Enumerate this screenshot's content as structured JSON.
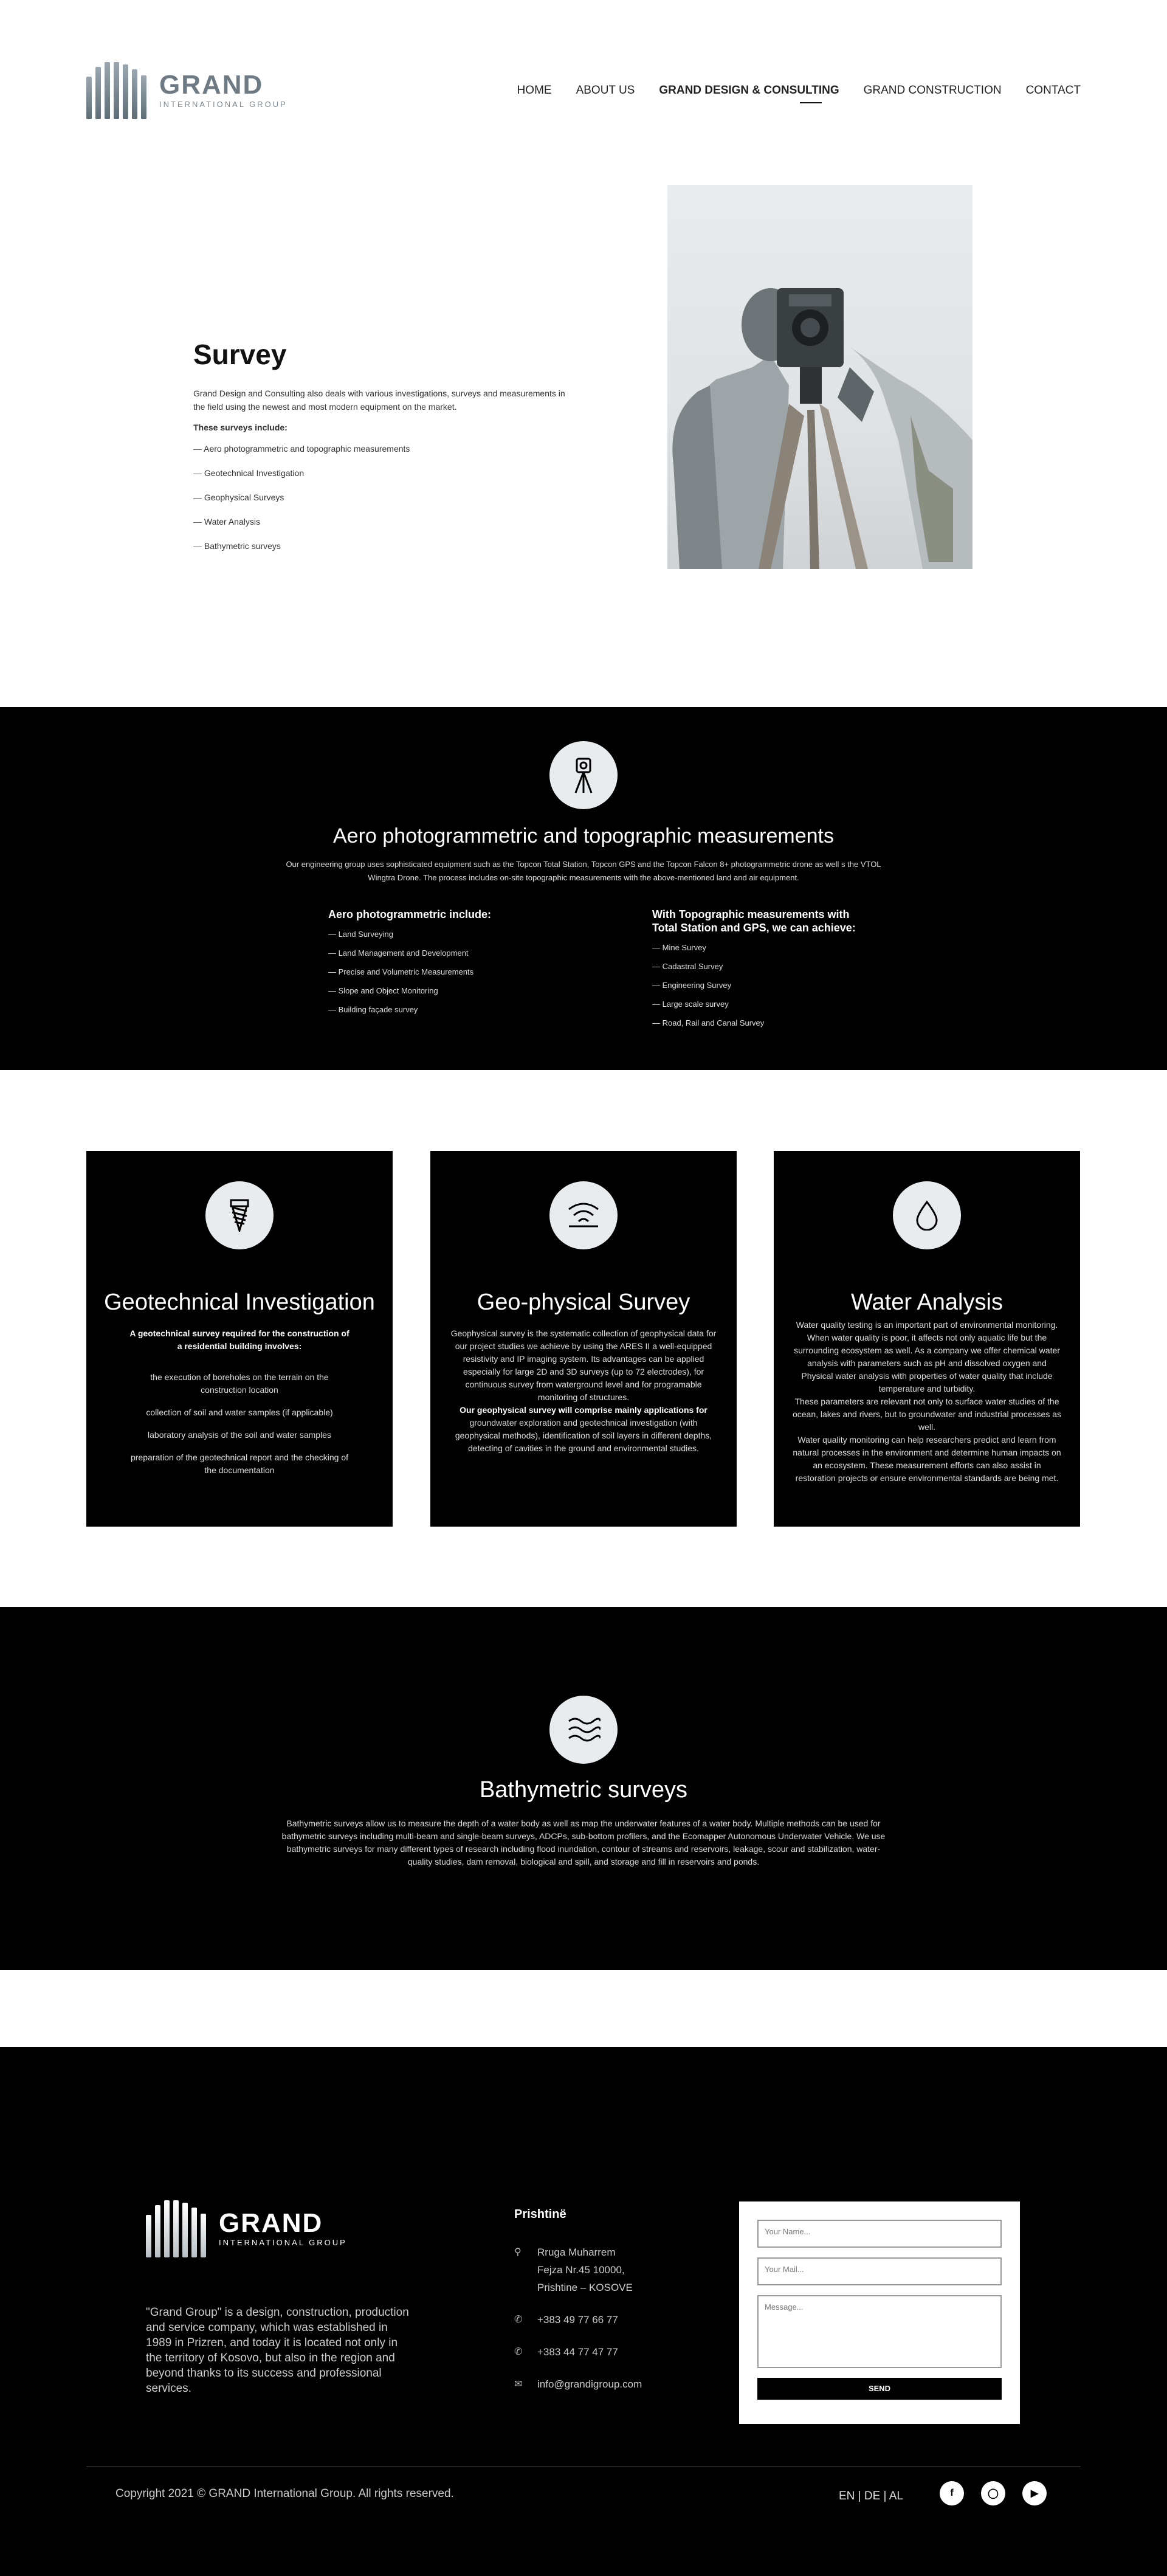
{
  "header": {
    "logo": {
      "name": "GRAND",
      "tagline": "INTERNATIONAL GROUP"
    },
    "nav": [
      "HOME",
      "ABOUT US",
      "GRAND DESIGN & CONSULTING",
      "GRAND CONSTRUCTION",
      "CONTACT"
    ]
  },
  "survey": {
    "title": "Survey",
    "description": "Grand Design and Consulting also deals with various investigations, surveys and measurements in the field using the newest and most modern equipment on the market.",
    "include_label": "These surveys include:",
    "items": [
      "Aero photogrammetric and topographic measurements",
      "Geotechnical Investigation",
      "Geophysical Surveys",
      "Water Analysis",
      "Bathymetric surveys"
    ]
  },
  "aero": {
    "title": "Aero photogrammetric and topographic measurements",
    "description": "Our engineering group uses sophisticated equipment such as the Topcon Total Station, Topcon GPS and the Topcon Falcon 8+ photogrammetric drone as well s the VTOL Wingtra Drone. The process includes on-site topographic measurements with the above-mentioned land and air equipment.",
    "left_title": "Aero photogrammetric include:",
    "left_items": [
      "Land Surveying",
      "Land Management and Development",
      "Precise and Volumetric Measurements",
      "Slope and Object Monitoring",
      "Building façade survey"
    ],
    "right_title": "With Topographic measurements with Total Station and GPS, we can achieve:",
    "right_items": [
      "Mine Survey",
      "Cadastral Survey",
      "Engineering Survey",
      "Large scale survey",
      "Road, Rail and Canal Survey"
    ]
  },
  "cards": {
    "geotech": {
      "title": "Geotechnical Investigation",
      "lead": "A geotechnical survey required for the construction of a residential building involves:",
      "items": [
        "the execution of boreholes on the terrain on the construction location",
        "collection of soil and water samples (if applicable)",
        "laboratory analysis of the soil and water samples",
        "preparation of the geotechnical report and the checking of the documentation"
      ]
    },
    "geophys": {
      "title": "Geo-physical Survey",
      "body": "Geophysical survey is the systematic collection of geophysical data for our project studies we achieve by using the ARES II a well-equipped resistivity and IP imaging system. Its advantages can be applied especially for large 2D and 3D surveys (up to 72 electrodes), for continuous survey from waterground level and for programable monitoring of structures.",
      "lead": "Our geophysical survey will comprise mainly applications for",
      "body2": "groundwater exploration and geotechnical investigation (with geophysical methods), identification of soil layers in different depths, detecting of cavities in the ground and environmental studies."
    },
    "water": {
      "title": "Water Analysis",
      "body": "Water quality testing is an important part of environmental monitoring. When water quality is poor, it affects not only aquatic life but the surrounding ecosystem as well. As a company we offer chemical water analysis with parameters such as pH and dissolved oxygen and Physical water analysis with properties of water quality that include temperature and turbidity.",
      "body2": "These parameters are relevant not only to surface water studies of the ocean, lakes and rivers, but to groundwater and industrial processes as well.",
      "body3": "Water quality monitoring can help researchers predict and learn from natural processes in the environment and determine human impacts on an ecosystem. These measurement efforts can also assist in restoration projects or ensure environmental standards are being met."
    }
  },
  "bathy": {
    "title": "Bathymetric surveys",
    "description": "Bathymetric surveys allow us to measure the depth of a water body as well as map the underwater features of a water body.  Multiple methods can be used for bathymetric surveys including multi-beam and single-beam surveys, ADCPs, sub-bottom profilers, and the Ecomapper Autonomous Underwater Vehicle. We use bathymetric surveys for many different types of research including flood inundation, contour of streams and reservoirs, leakage, scour and stabilization, water-quality studies, dam removal, biological and spill, and storage and fill in reservoirs and ponds."
  },
  "footer": {
    "about": "\"Grand Group\" is a design, construction, production and service company, which was established in 1989 in Prizren, and today it is located not only in the territory of Kosovo, but also in the region and beyond thanks to its success and professional services.",
    "city": "Prishtinë",
    "address_1": "Rruga Muharrem",
    "address_2": "Fejza Nr.45 10000,",
    "address_3": "Prishtine – KOSOVE",
    "phone_1": "+383 49 77 66 77",
    "phone_2": "+383 44 77 47 77",
    "email": "info@grandigroup.com",
    "form": {
      "name_placeholder": "Your Name...",
      "mail_placeholder": "Your Mail...",
      "message_placeholder": "Message...",
      "send": "SEND"
    },
    "copyright": "Copyright 2021 © GRAND International Group. All rights reserved.",
    "languages": "EN | DE | AL",
    "social": [
      "facebook-icon",
      "instagram-icon",
      "youtube-icon"
    ]
  }
}
